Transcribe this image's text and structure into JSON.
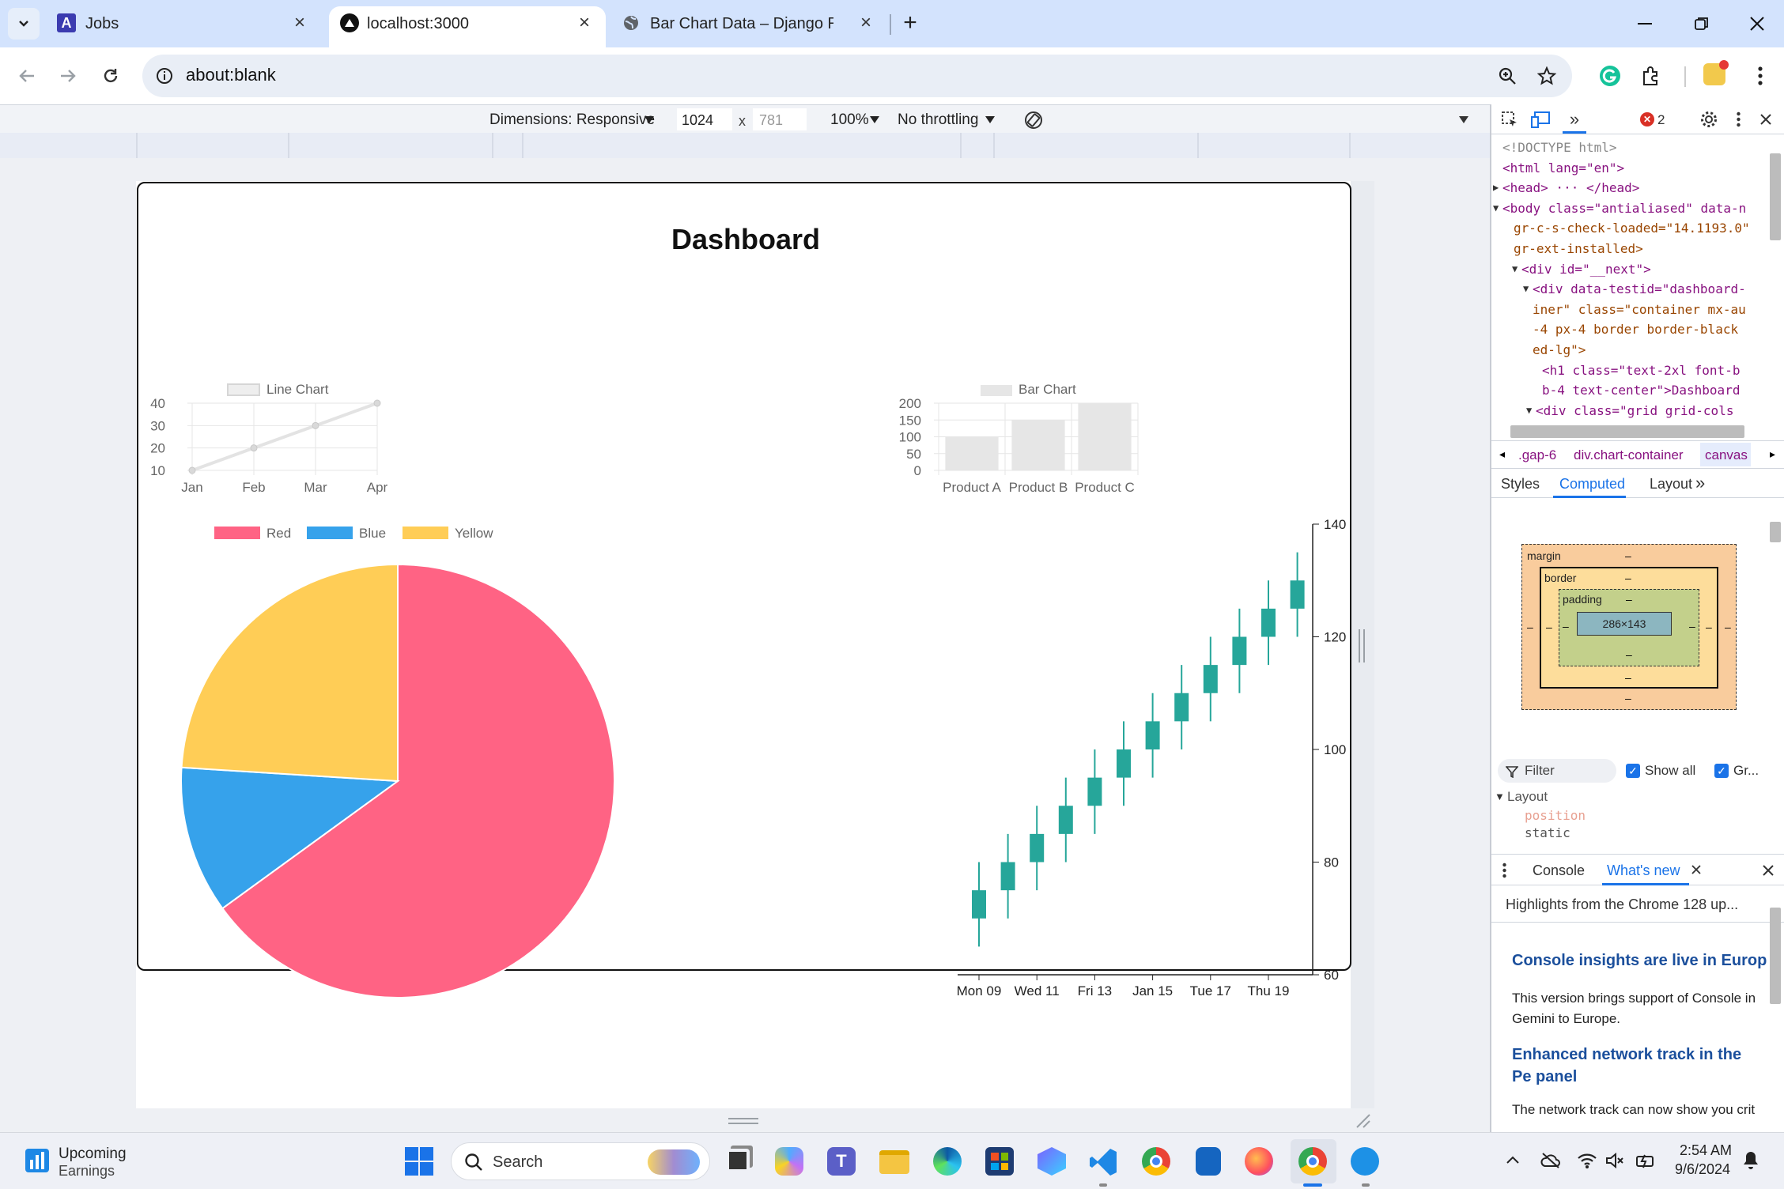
{
  "browser": {
    "tabs": [
      {
        "title": "Jobs",
        "favicon": "letter-a-icon"
      },
      {
        "title": "localhost:3000",
        "favicon": "triangle-logo-icon",
        "active": true
      },
      {
        "title": "Bar Chart Data – Django REST fr",
        "favicon": "globe-icon"
      }
    ],
    "url": "about:blank"
  },
  "devtools_toolbar": {
    "dimensions_label": "Dimensions: Responsive",
    "width": "1024",
    "height_placeholder": "781",
    "times": "x",
    "zoom": "100%",
    "throttling": "No throttling"
  },
  "dashboard": {
    "title": "Dashboard",
    "colors": {
      "red": "#ff6384",
      "blue": "#36a2eb",
      "yellow": "#ffcd56",
      "teal": "#26a69a",
      "gray": "#e6e6e6"
    }
  },
  "chart_data": [
    {
      "type": "line",
      "legend": "Line Chart",
      "categories": [
        "Jan",
        "Feb",
        "Mar",
        "Apr"
      ],
      "series": [
        {
          "name": "Line Chart",
          "values": [
            10,
            20,
            30,
            40
          ]
        }
      ],
      "ylim": [
        10,
        40
      ],
      "yticks": [
        "40",
        "30",
        "20",
        "10"
      ]
    },
    {
      "type": "bar",
      "legend": "Bar Chart",
      "categories": [
        "Product A",
        "Product B",
        "Product C"
      ],
      "series": [
        {
          "name": "Bar Chart",
          "values": [
            100,
            150,
            200
          ]
        }
      ],
      "ylim": [
        0,
        200
      ],
      "yticks": [
        "200",
        "150",
        "100",
        "50",
        "0"
      ]
    },
    {
      "type": "pie",
      "labels": [
        "Red",
        "Blue",
        "Yellow"
      ],
      "values": [
        65,
        11,
        24
      ],
      "colors": [
        "#ff6384",
        "#36a2eb",
        "#ffcd56"
      ]
    },
    {
      "type": "candlestick",
      "xticks": [
        "Mon 09",
        "Wed 11",
        "Fri 13",
        "Jan 15",
        "Tue 17",
        "Thu 19"
      ],
      "yticks": [
        "140",
        "120",
        "100",
        "80",
        "60"
      ],
      "ylim": [
        60,
        140
      ],
      "candles": [
        {
          "o": 70,
          "c": 75,
          "h": 80,
          "l": 65
        },
        {
          "o": 75,
          "c": 80,
          "h": 85,
          "l": 70
        },
        {
          "o": 80,
          "c": 85,
          "h": 90,
          "l": 75
        },
        {
          "o": 85,
          "c": 90,
          "h": 95,
          "l": 80
        },
        {
          "o": 90,
          "c": 95,
          "h": 100,
          "l": 85
        },
        {
          "o": 95,
          "c": 100,
          "h": 105,
          "l": 90
        },
        {
          "o": 100,
          "c": 105,
          "h": 110,
          "l": 95
        },
        {
          "o": 105,
          "c": 110,
          "h": 115,
          "l": 100
        },
        {
          "o": 110,
          "c": 115,
          "h": 120,
          "l": 105
        },
        {
          "o": 115,
          "c": 120,
          "h": 125,
          "l": 110
        },
        {
          "o": 120,
          "c": 125,
          "h": 130,
          "l": 115
        },
        {
          "o": 125,
          "c": 130,
          "h": 135,
          "l": 120
        }
      ]
    }
  ],
  "devtools": {
    "errors": "2",
    "dom_lines": [
      "<!DOCTYPE html>",
      "<html lang=\"en\">",
      "<head> ··· </head>",
      "<body class=\"antialiased\" data-n",
      "gr-c-s-check-loaded=\"14.1193.0\"",
      "gr-ext-installed>",
      "<div id=\"__next\">",
      "<div data-testid=\"dashboard-",
      "iner\" class=\"container mx-au",
      "-4 px-4 border border-black",
      "ed-lg\">",
      "<h1 class=\"text-2xl font-b",
      "b-4 text-center\">Dashboard",
      "<div class=\"grid grid-cols"
    ],
    "breadcrumbs": [
      ".gap-6",
      "div.chart-container",
      "canvas"
    ],
    "panel_tabs": [
      "Styles",
      "Computed",
      "Layout"
    ],
    "box_model": {
      "margin": "margin",
      "border": "border",
      "padding": "padding",
      "content": "286×143",
      "dash": "–"
    },
    "filter_placeholder": "Filter",
    "show_all": "Show all",
    "group": "Gr...",
    "layout_section": "Layout",
    "prop_name": "position",
    "prop_value": "static",
    "drawer_tabs": [
      "Console",
      "What's new"
    ],
    "whatsnew_header": "Highlights from the Chrome 128 up...",
    "article1_title": "Console insights are live in Europ",
    "article1_body": "This version brings support of Console in Gemini to Europe.",
    "article2_title": "Enhanced network track in the Pe panel",
    "article2_body": "The network track can now show you crit"
  },
  "taskbar": {
    "widget_title": "Upcoming",
    "widget_subtitle": "Earnings",
    "search": "Search",
    "time": "2:54 AM",
    "date": "9/6/2024"
  }
}
